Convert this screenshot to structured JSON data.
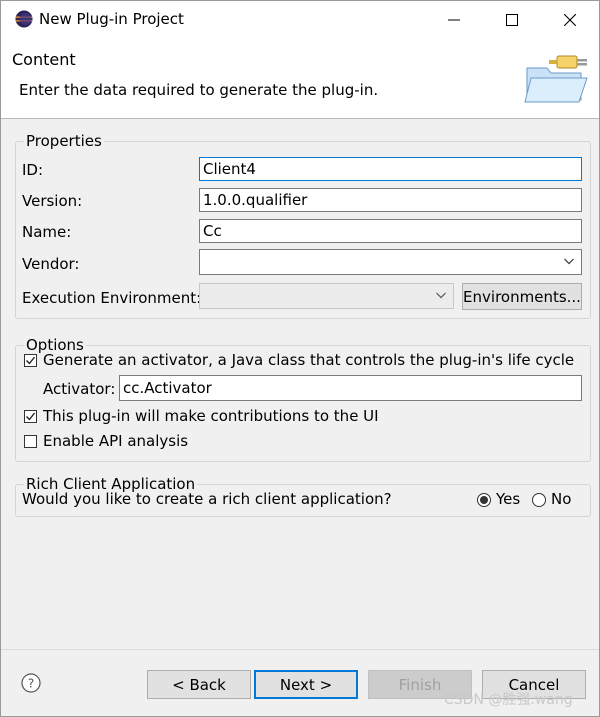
{
  "window": {
    "title": "New Plug-in Project",
    "icon": "eclipse-icon",
    "controls": [
      "minimize-icon",
      "maximize-icon",
      "close-icon"
    ]
  },
  "header": {
    "title": "Content",
    "description": "Enter the data required to generate the plug-in.",
    "image": "plugin-folder-icon"
  },
  "properties": {
    "group_label": "Properties",
    "id_label": "ID:",
    "id_value": "Client4",
    "version_label": "Version:",
    "version_value": "1.0.0.qualifier",
    "name_label": "Name:",
    "name_value": "Cc",
    "vendor_label": "Vendor:",
    "vendor_value": "",
    "exec_env_label": "Execution Environment:",
    "exec_env_value": "",
    "environments_button": "Environments..."
  },
  "options": {
    "group_label": "Options",
    "generate_activator_label": "Generate an activator, a Java class that controls the plug-in's life cycle",
    "generate_activator_checked": true,
    "activator_label": "Activator:",
    "activator_value": "cc.Activator",
    "ui_contrib_label": "This plug-in will make contributions to the UI",
    "ui_contrib_checked": true,
    "api_analysis_label": "Enable API analysis",
    "api_analysis_checked": false
  },
  "rca": {
    "group_label": "Rich Client Application",
    "question": "Would you like to create a rich client application?",
    "yes_label": "Yes",
    "no_label": "No",
    "selected": "Yes"
  },
  "footer": {
    "help_icon": "help-icon",
    "back_label": "< Back",
    "next_label": "Next >",
    "finish_label": "Finish",
    "cancel_label": "Cancel"
  },
  "watermark": "CSDN @胜强.wang",
  "colors": {
    "window_bg": "#f0f0f0",
    "focus_border": "#0078d7",
    "button_bg": "#e1e1e1"
  }
}
